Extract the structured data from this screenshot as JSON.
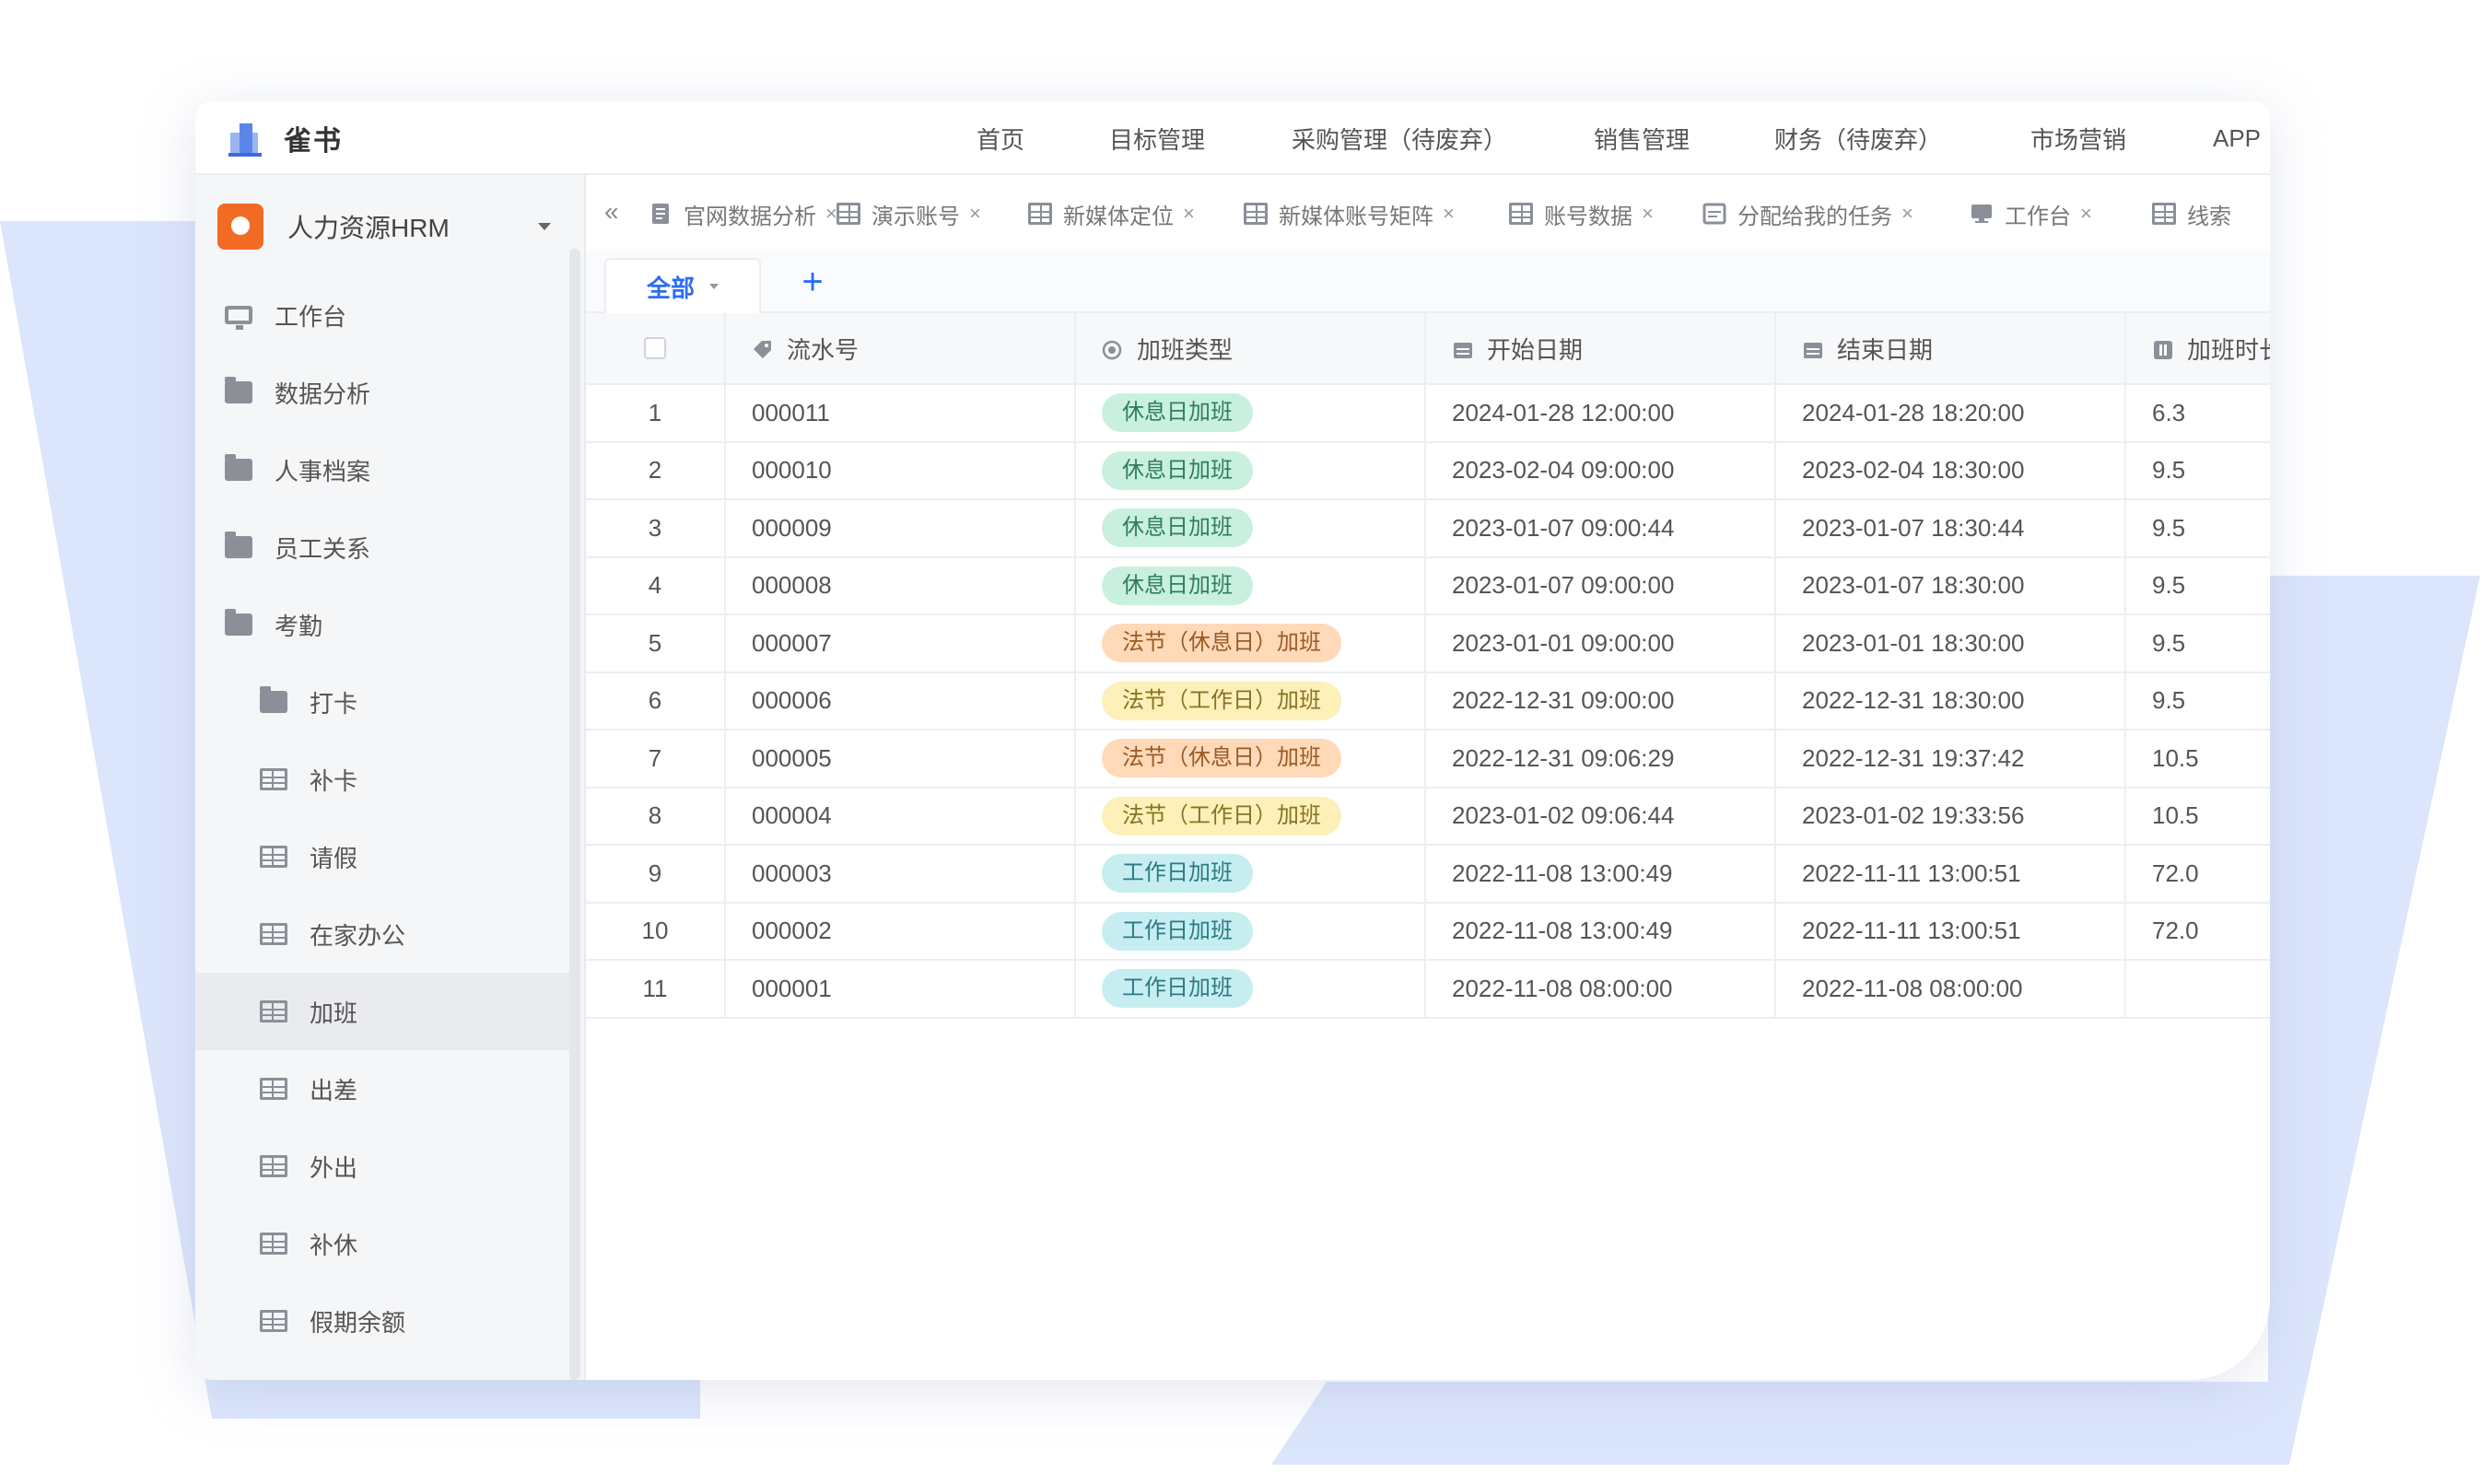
{
  "brand": {
    "name": "雀书"
  },
  "topnav": [
    "首页",
    "目标管理",
    "采购管理（待废弃）",
    "销售管理",
    "财务（待废弃）",
    "市场营销",
    "APP"
  ],
  "app_switcher": {
    "name": "人力资源HRM"
  },
  "sidebar": {
    "items": [
      {
        "label": "工作台",
        "icon": "monitor-icon",
        "level": 1
      },
      {
        "label": "数据分析",
        "icon": "folder-icon",
        "level": 1
      },
      {
        "label": "人事档案",
        "icon": "folder-icon",
        "level": 1
      },
      {
        "label": "员工关系",
        "icon": "folder-icon",
        "level": 1
      },
      {
        "label": "考勤",
        "icon": "folder-icon",
        "level": 1
      },
      {
        "label": "打卡",
        "icon": "folder-icon",
        "level": 2
      },
      {
        "label": "补卡",
        "icon": "table-icon",
        "level": 2
      },
      {
        "label": "请假",
        "icon": "table-icon",
        "level": 2
      },
      {
        "label": "在家办公",
        "icon": "table-icon",
        "level": 2
      },
      {
        "label": "加班",
        "icon": "table-icon",
        "level": 2,
        "active": true
      },
      {
        "label": "出差",
        "icon": "table-icon",
        "level": 2
      },
      {
        "label": "外出",
        "icon": "table-icon",
        "level": 2
      },
      {
        "label": "补休",
        "icon": "table-icon",
        "level": 2
      },
      {
        "label": "假期余额",
        "icon": "table-icon",
        "level": 2
      }
    ]
  },
  "tabs": [
    {
      "label": "官网数据分析",
      "icon": "document-icon"
    },
    {
      "label": "演示账号",
      "icon": "table-icon"
    },
    {
      "label": "新媒体定位",
      "icon": "table-icon"
    },
    {
      "label": "新媒体账号矩阵",
      "icon": "table-icon"
    },
    {
      "label": "账号数据",
      "icon": "table-icon"
    },
    {
      "label": "分配给我的任务",
      "icon": "form-icon"
    },
    {
      "label": "工作台",
      "icon": "monitor-icon"
    },
    {
      "label": "线索",
      "icon": "table-icon"
    }
  ],
  "tab_close": "×",
  "collapse_glyph": "«",
  "view": {
    "label": "全部",
    "add": "+"
  },
  "table": {
    "columns": [
      "流水号",
      "加班类型",
      "开始日期",
      "结束日期",
      "加班时长"
    ],
    "rows": [
      {
        "no": "1",
        "serial": "000011",
        "type": "休息日加班",
        "kind": "rest",
        "start": "2024-01-28 12:00:00",
        "end": "2024-01-28 18:20:00",
        "hours": "6.3"
      },
      {
        "no": "2",
        "serial": "000010",
        "type": "休息日加班",
        "kind": "rest",
        "start": "2023-02-04 09:00:00",
        "end": "2023-02-04 18:30:00",
        "hours": "9.5"
      },
      {
        "no": "3",
        "serial": "000009",
        "type": "休息日加班",
        "kind": "rest",
        "start": "2023-01-07 09:00:44",
        "end": "2023-01-07 18:30:44",
        "hours": "9.5"
      },
      {
        "no": "4",
        "serial": "000008",
        "type": "休息日加班",
        "kind": "rest",
        "start": "2023-01-07 09:00:00",
        "end": "2023-01-07 18:30:00",
        "hours": "9.5"
      },
      {
        "no": "5",
        "serial": "000007",
        "type": "法节（休息日）加班",
        "kind": "holiday-rest",
        "start": "2023-01-01 09:00:00",
        "end": "2023-01-01 18:30:00",
        "hours": "9.5"
      },
      {
        "no": "6",
        "serial": "000006",
        "type": "法节（工作日）加班",
        "kind": "holiday-work",
        "start": "2022-12-31 09:00:00",
        "end": "2022-12-31 18:30:00",
        "hours": "9.5"
      },
      {
        "no": "7",
        "serial": "000005",
        "type": "法节（休息日）加班",
        "kind": "holiday-rest",
        "start": "2022-12-31 09:06:29",
        "end": "2022-12-31 19:37:42",
        "hours": "10.5"
      },
      {
        "no": "8",
        "serial": "000004",
        "type": "法节（工作日）加班",
        "kind": "holiday-work",
        "start": "2023-01-02 09:06:44",
        "end": "2023-01-02 19:33:56",
        "hours": "10.5"
      },
      {
        "no": "9",
        "serial": "000003",
        "type": "工作日加班",
        "kind": "workday",
        "start": "2022-11-08 13:00:49",
        "end": "2022-11-11 13:00:51",
        "hours": "72.0"
      },
      {
        "no": "10",
        "serial": "000002",
        "type": "工作日加班",
        "kind": "workday",
        "start": "2022-11-08 13:00:49",
        "end": "2022-11-11 13:00:51",
        "hours": "72.0"
      },
      {
        "no": "11",
        "serial": "000001",
        "type": "工作日加班",
        "kind": "workday",
        "start": "2022-11-08 08:00:00",
        "end": "2022-11-08 08:00:00",
        "hours": ""
      }
    ]
  },
  "colors": {
    "accent": "#2a6df4",
    "app_icon": "#f26b25",
    "background_shape": "#dbe5fb",
    "tag_rest": "#c9f0df",
    "tag_holiday_rest": "#ffd9b8",
    "tag_holiday_work": "#fdf0b9",
    "tag_workday": "#c6eef0"
  }
}
